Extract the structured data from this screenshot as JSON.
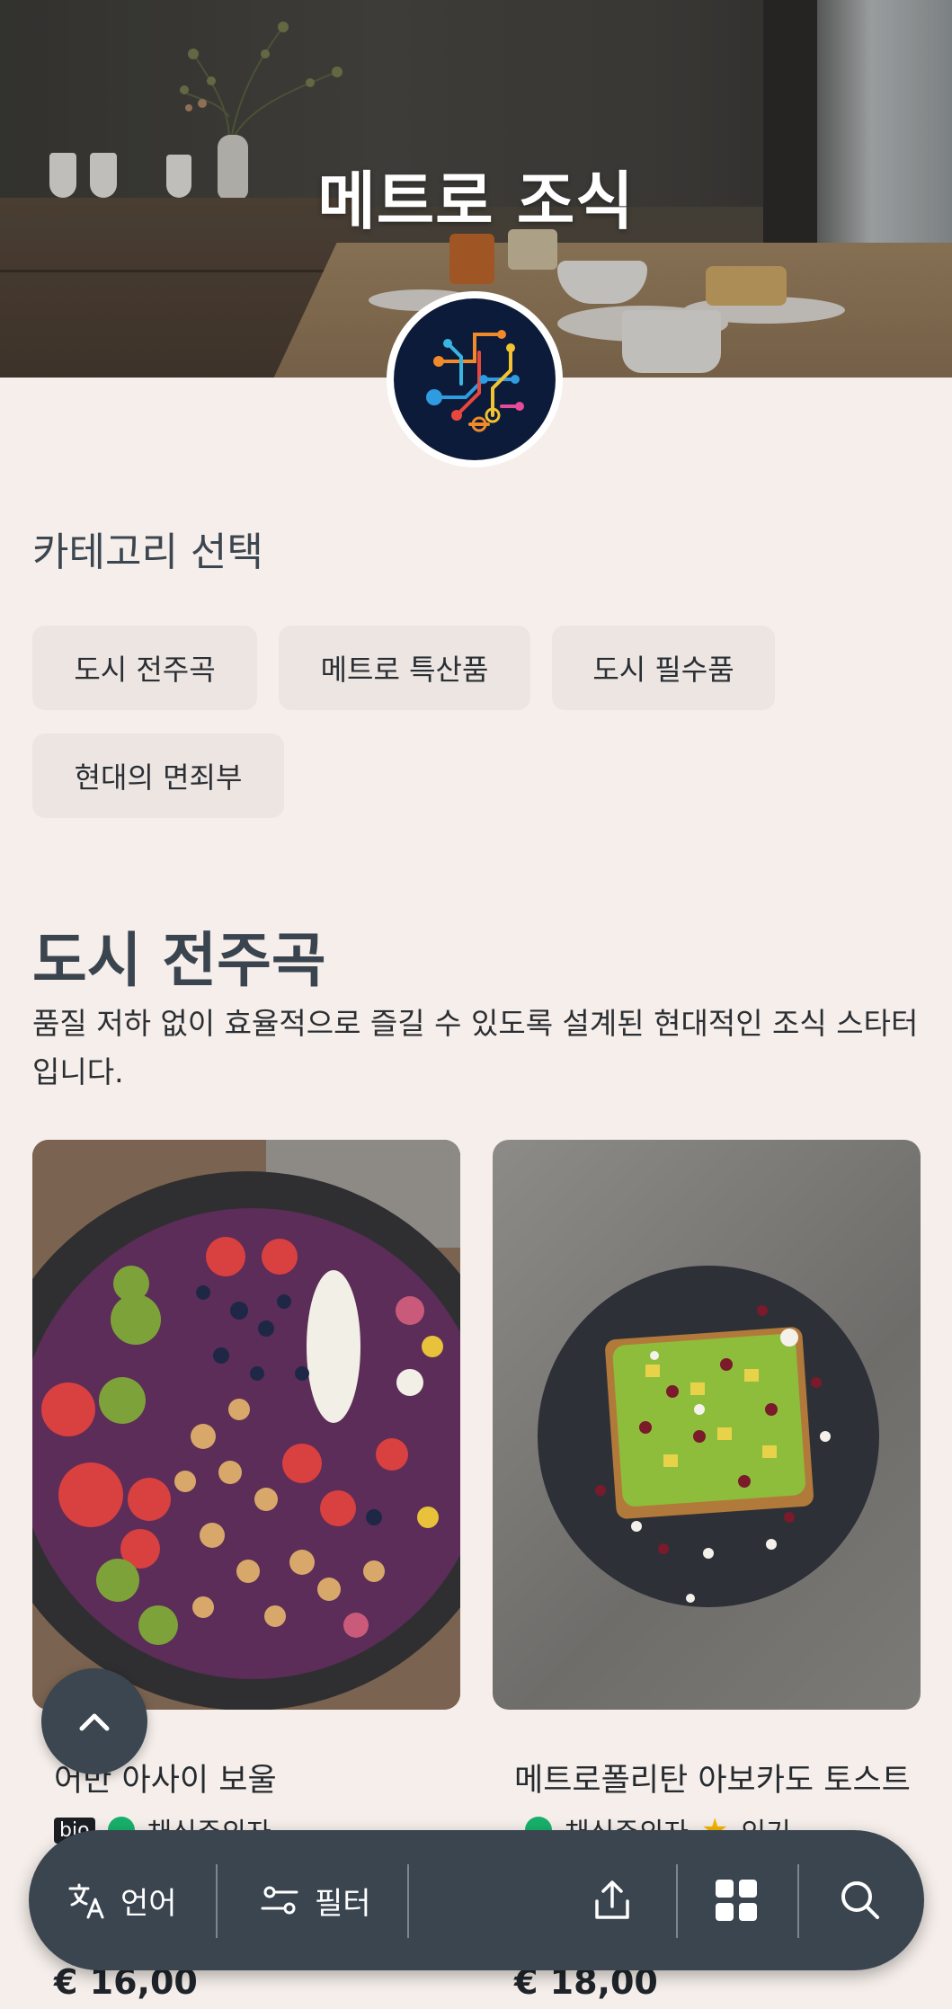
{
  "hero": {
    "title": "메트로 조식"
  },
  "category": {
    "title": "카테고리 선택",
    "chips": [
      "도시 전주곡",
      "메트로 특산품",
      "도시 필수품",
      "현대의 면죄부"
    ]
  },
  "section": {
    "title": "도시 전주곡",
    "description": "품질 저하 없이 효율적으로 즐길 수 있도록 설계된 현대적인 조식 스타터입니다."
  },
  "products": [
    {
      "name": "어반 아사이 보울",
      "tags": [
        "bio",
        "채식주의자"
      ],
      "price": "€ 16,00"
    },
    {
      "name": "메트로폴리탄 아보카도 토스트",
      "tags": [
        "채식주의자",
        "인기"
      ],
      "price": "€ 18,00"
    }
  ],
  "bottom_bar": {
    "language_label": "언어",
    "filter_label": "필터"
  },
  "colors": {
    "background": "#f5eeea",
    "bar": "#3a4550",
    "chip": "#ece5e1",
    "vegan_badge": "#18b06a",
    "star": "#f4b400"
  },
  "icons": [
    "translate-icon",
    "filter-icon",
    "share-icon",
    "grid-icon",
    "search-icon",
    "chevron-up-icon",
    "leaf-icon",
    "star-icon"
  ]
}
